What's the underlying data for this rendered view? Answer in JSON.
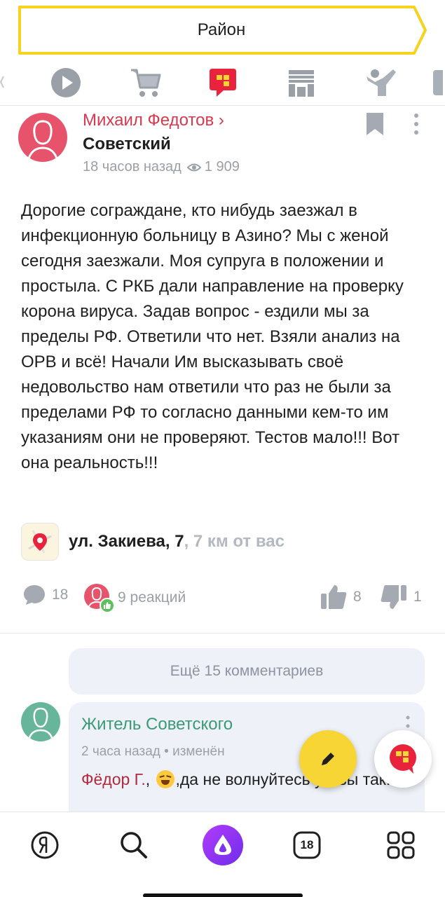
{
  "top_bar": {
    "district_label": "Район"
  },
  "category_icons": [
    {
      "name": "play-icon"
    },
    {
      "name": "cart-icon"
    },
    {
      "name": "chat-icon",
      "active": true
    },
    {
      "name": "store-icon"
    },
    {
      "name": "people-icon"
    }
  ],
  "post": {
    "author": "Михаил Федотов ›",
    "district": "Советский",
    "time": "18 часов назад",
    "views": "1 909",
    "text": "Дорогие сограждане, кто нибудь заезжал в инфекционную больницу в Азино? Мы с женой сегодня заезжали. Моя супруга в положении и простыла. С РКБ дали направление на проверку корона вируса. Задав вопрос - ездили мы за пределы РФ. Ответили что нет. Взяли анализ на ОРВ и всё! Начали Им высказывать своё недовольство нам ответили что раз не были за пределами РФ то согласно данными кем-то им указаниям они не проверяют. Тестов мало!!! Вот она реальность!!!",
    "address": "ул. Закиева, 7",
    "distance": ", 7 км от вас",
    "comments_count": "18",
    "reactions": "9 реакций",
    "likes": "8",
    "dislikes": "1"
  },
  "comments": {
    "more_label": "Ещё 15 комментариев",
    "first": {
      "author": "Житель Советского",
      "meta": "2 часа назад • изменён",
      "reply_to": "Фёдор Г.",
      "text_start": ",",
      "text_rest": ",да не волнуйтесь уж вы так."
    }
  },
  "bottom_nav": {
    "calendar_day": "18"
  },
  "colors": {
    "accent_yellow": "#f7d534",
    "brand_red": "#e8233b",
    "author_red": "#d63a4f",
    "comment_green": "#3a9a75",
    "alice_purple": "#8a2be2"
  }
}
